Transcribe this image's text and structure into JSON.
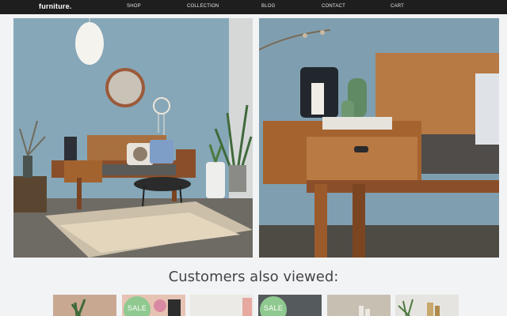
{
  "header": {
    "brand": "furniture.",
    "nav": [
      {
        "label": "SHOP"
      },
      {
        "label": "COLLECTION"
      },
      {
        "label": "BLOG"
      },
      {
        "label": "CONTACT"
      },
      {
        "label": "CART"
      }
    ]
  },
  "hero": {
    "left_image": "living-room-bench-scene",
    "right_image": "bench-drawer-closeup"
  },
  "recommendations": {
    "heading": "Customers also viewed:",
    "items": [
      {
        "badge": ""
      },
      {
        "badge": "SALE"
      },
      {
        "badge": ""
      },
      {
        "badge": "SALE"
      },
      {
        "badge": ""
      },
      {
        "badge": ""
      }
    ]
  },
  "colors": {
    "nav_bg": "#1e1e1e",
    "wall_blue": "#86a7b8",
    "wood": "#a0643a",
    "sale_badge": "#8fc98f"
  }
}
